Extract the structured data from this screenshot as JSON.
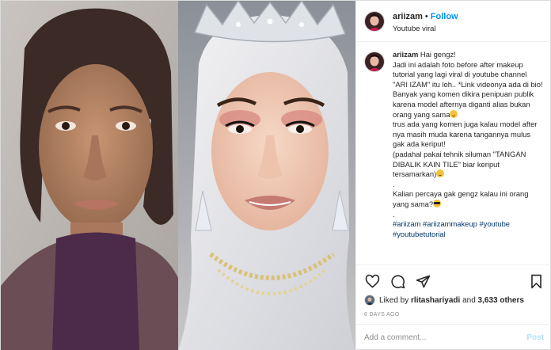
{
  "header": {
    "username": "ariizam",
    "separator": "•",
    "follow_label": "Follow",
    "location": "Youtube viral"
  },
  "caption": {
    "username": "ariizam",
    "lines": [
      "Hai gengz!",
      "Jadi ini adalah foto before after makeup tutorial yang lagi viral di youtube channel \"ARI IZAM\" itu loh.. *Link videonya ada di bio!",
      "Banyak yang komen dikira penipuan publik karena model afternya diganti alias bukan orang yang sama",
      "trus ada yang komen juga kalau model after nya masih muda karena tangannya mulus gak ada keriput!",
      "(padahal pakai tehnik siluman \"TANGAN DIBALIK KAIN TILE\" biar keriput tersamarkan)",
      ".",
      "Kalian percaya gak gengz kalau ini orang yang sama?",
      "."
    ],
    "hashtags": [
      "#ariizam",
      "#ariizammakeup",
      "#youtube",
      "#youtubetutorial"
    ]
  },
  "actions": {
    "icons": [
      "heart-icon",
      "comment-icon",
      "share-icon",
      "bookmark-icon"
    ],
    "likes_prefix": "Liked by",
    "likes_user": "rlitashariyadi",
    "likes_and": "and",
    "likes_count": "3,633 others",
    "date": "6 DAYS AGO"
  },
  "comment": {
    "placeholder": "Add a comment...",
    "post_label": "Post"
  },
  "colors": {
    "accent": "#0095f6",
    "hashtag": "#00376b",
    "post_disabled": "#b2dffc",
    "border": "#dbdbdb"
  }
}
